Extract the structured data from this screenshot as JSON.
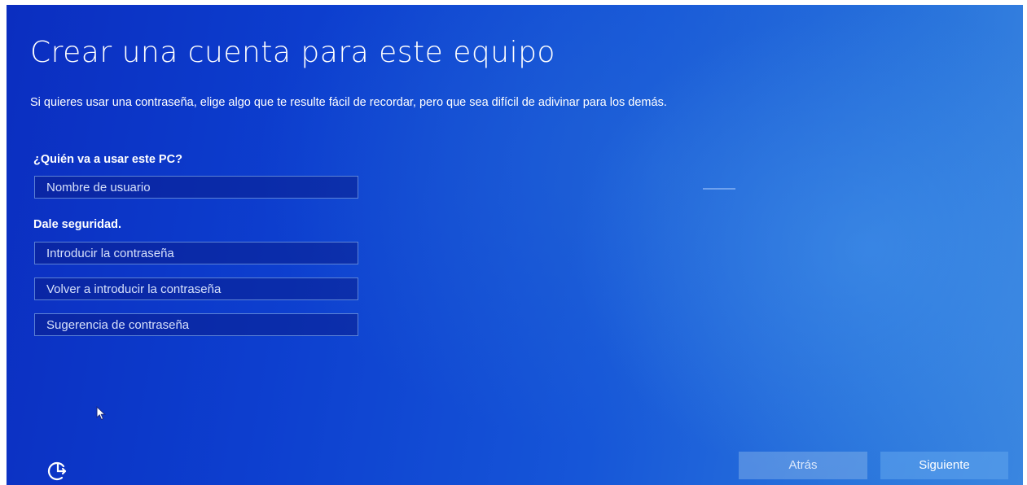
{
  "page": {
    "title": "Crear una cuenta para este equipo",
    "description": "Si quieres usar una contraseña, elige algo que te resulte fácil de recordar, pero que sea difícil de adivinar para los demás."
  },
  "user_section": {
    "label": "¿Quién va a usar este PC?",
    "username_placeholder": "Nombre de usuario"
  },
  "security_section": {
    "label": "Dale seguridad.",
    "password_placeholder": "Introducir la contraseña",
    "confirm_password_placeholder": "Volver a introducir la contraseña",
    "password_hint_placeholder": "Sugerencia de contraseña"
  },
  "footer": {
    "back_label": "Atrás",
    "next_label": "Siguiente",
    "accessibility_icon": "ease-of-access-icon"
  },
  "icons": {
    "mouse_cursor": "mouse-pointer-icon"
  }
}
